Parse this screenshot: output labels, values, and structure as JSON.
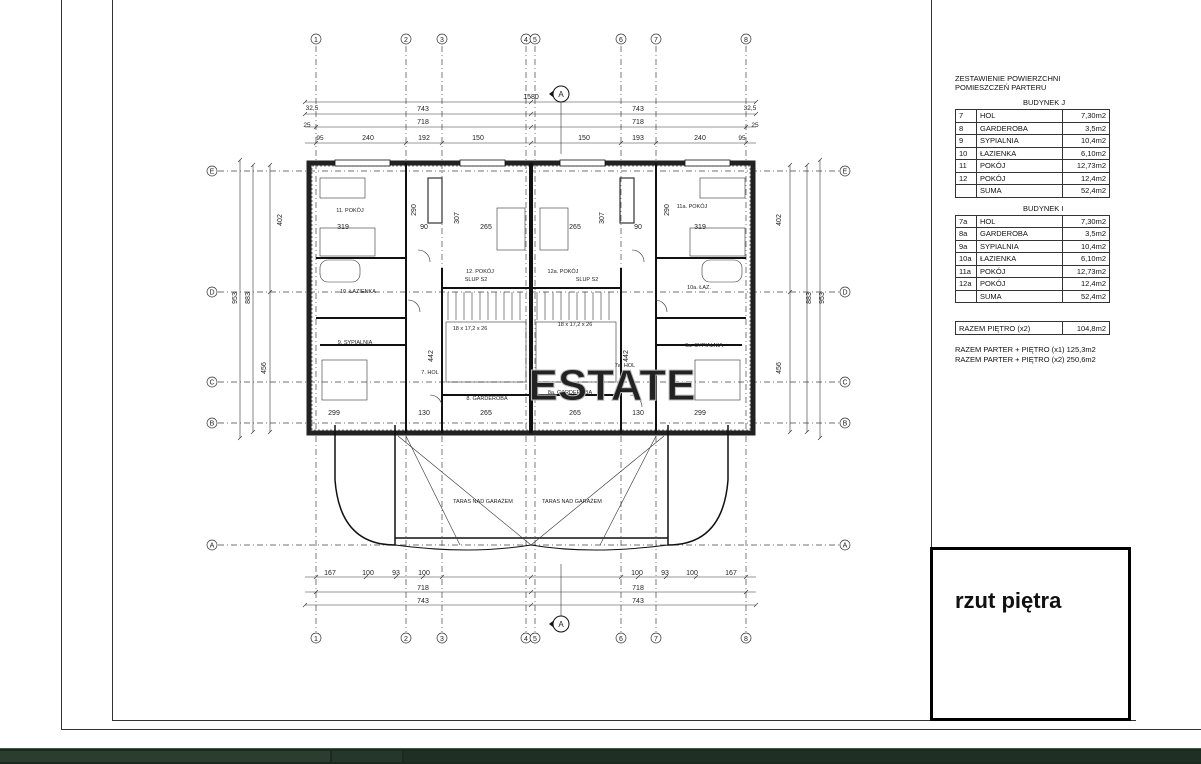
{
  "axes": {
    "top": [
      "1",
      "2",
      "3",
      "4",
      "5",
      "6",
      "7",
      "8"
    ],
    "side": [
      "E",
      "D",
      "C",
      "B",
      "A"
    ],
    "section_marker": "A"
  },
  "dimensions": {
    "overall": "1580",
    "half_outer": "743",
    "half_inner": "718",
    "top_segments": [
      "240",
      "192",
      "150",
      "150",
      "193",
      "240"
    ],
    "small_ends": [
      "32,5",
      "25",
      "95",
      "95",
      "25",
      "32,5"
    ],
    "bottom_segments": [
      "167",
      "100",
      "93",
      "100",
      "100",
      "93",
      "100",
      "167"
    ],
    "left_vertical": [
      "953",
      "883",
      "402",
      "456"
    ],
    "right_vertical": [
      "953",
      "883",
      "402",
      "456"
    ],
    "room_widths": [
      "319",
      "90",
      "265",
      "265",
      "90",
      "319",
      "299",
      "130",
      "265",
      "265",
      "130",
      "299"
    ],
    "interior": [
      "290",
      "307",
      "307",
      "290",
      "442",
      "442"
    ]
  },
  "plan_labels": {
    "rooms": [
      "11. POKÓJ",
      "12. POKÓJ",
      "12a. POKÓJ",
      "11a. POKÓJ",
      "10. ŁAZIENKA",
      "10a. ŁAZ.",
      "9. SYPIALNIA",
      "9a. SYPIALNIA",
      "7. HOL",
      "7a. HOL",
      "8. GARDEROBA",
      "8a. GARDEROBA",
      "SLUP S2",
      "SLUP S2",
      "18 x 17,2 x 26",
      "18 x 17,2 x 26",
      "TARAS NAD GARAŻEM",
      "TARAS NAD GARAŻEM"
    ],
    "watermark": "ESTATE"
  },
  "schedule": {
    "title_line1": "ZESTAWIENIE POWIERZCHNI",
    "title_line2": "POMIESZCZEŃ PARTERU",
    "building_j": {
      "label": "BUDYNEK J",
      "rows": [
        {
          "no": "7",
          "name": "HOL",
          "area": "7,30m2"
        },
        {
          "no": "8",
          "name": "GARDEROBA",
          "area": "3,5m2"
        },
        {
          "no": "9",
          "name": "SYPIALNIA",
          "area": "10,4m2"
        },
        {
          "no": "10",
          "name": "ŁAZIENKA",
          "area": "6,10m2"
        },
        {
          "no": "11",
          "name": "POKÓJ",
          "area": "12,73m2"
        },
        {
          "no": "12",
          "name": "POKÓJ",
          "area": "12,4m2"
        },
        {
          "no": "",
          "name": "SUMA",
          "area": "52,4m2"
        }
      ]
    },
    "building_i": {
      "label": "BUDYNEK I",
      "rows": [
        {
          "no": "7a",
          "name": "HOL",
          "area": "7,30m2"
        },
        {
          "no": "8a",
          "name": "GARDEROBA",
          "area": "3,5m2"
        },
        {
          "no": "9a",
          "name": "SYPIALNIA",
          "area": "10,4m2"
        },
        {
          "no": "10a",
          "name": "ŁAZIENKA",
          "area": "6,10m2"
        },
        {
          "no": "11a",
          "name": "POKÓJ",
          "area": "12,73m2"
        },
        {
          "no": "12a",
          "name": "POKÓJ",
          "area": "12,4m2"
        },
        {
          "no": "",
          "name": "SUMA",
          "area": "52,4m2"
        }
      ]
    },
    "razem": {
      "name": "RAZEM PIĘTRO (x2)",
      "area": "104,8m2"
    },
    "totals": [
      "RAZEM PARTER + PIĘTRO (x1) 125,3m2",
      "RAZEM PARTER + PIĘTRO (x2) 250,6m2"
    ]
  },
  "title_box": {
    "text": "rzut piętra"
  }
}
